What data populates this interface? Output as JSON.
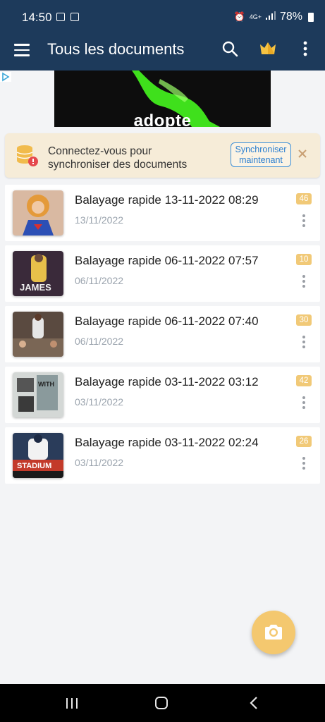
{
  "status_bar": {
    "time": "14:50",
    "network": "4G+",
    "battery": "78%"
  },
  "app_bar": {
    "title": "Tous les documents",
    "icons": [
      "menu-icon",
      "search-icon",
      "crown-icon",
      "more-vertical-icon"
    ]
  },
  "ad": {
    "text": "adopte"
  },
  "banner": {
    "message": "Connectez-vous pour synchroniser des documents",
    "button_label": "Synchroniser maintenant"
  },
  "documents": [
    {
      "title": "Balayage rapide 13-11-2022 08:29",
      "date": "13/11/2022",
      "pages": "46",
      "thumb_color": "#c98a6a"
    },
    {
      "title": "Balayage rapide 06-11-2022 07:57",
      "date": "06/11/2022",
      "pages": "10",
      "thumb_color": "#4b3b4a"
    },
    {
      "title": "Balayage rapide 06-11-2022 07:40",
      "date": "06/11/2022",
      "pages": "30",
      "thumb_color": "#6b5a4e"
    },
    {
      "title": "Balayage rapide 03-11-2022 03:12",
      "date": "03/11/2022",
      "pages": "42",
      "thumb_color": "#9aa4a6"
    },
    {
      "title": "Balayage rapide 03-11-2022 02:24",
      "date": "03/11/2022",
      "pages": "26",
      "thumb_color": "#3a4a6a"
    }
  ],
  "colors": {
    "header": "#1d3a5b",
    "accent": "#f4c86f",
    "link": "#2b7fd0"
  }
}
